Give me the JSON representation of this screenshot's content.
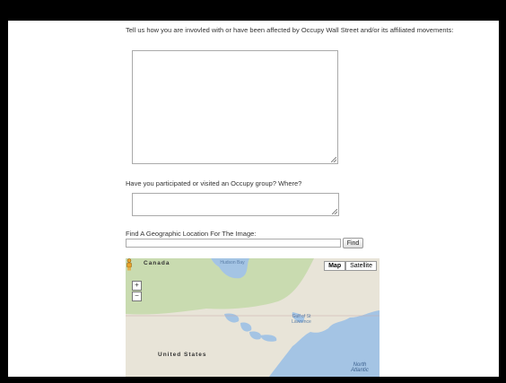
{
  "form": {
    "question_involvement": "Tell us how you are invovled with or have been affected by Occupy Wall Street and/or its affiliated movements:",
    "question_groups": "Have you participated or visited an Occupy group? Where?",
    "geo_label": "Find A Geographic Location For The Image:",
    "geo_input_value": "",
    "find_button": "Find"
  },
  "map": {
    "map_button": "Map",
    "satellite_button": "Satellite",
    "zoom_in": "+",
    "zoom_out": "−",
    "labels": {
      "canada": "Canada",
      "hudson_bay": "Hudson Bay",
      "united_states": "United States",
      "north_atlantic": "North Atlantic",
      "gulf": "Gulf of St Lawrence"
    },
    "colors": {
      "water": "#a4c4e4",
      "land": "#e8e4d8",
      "forest": "#c9dbb0"
    }
  }
}
